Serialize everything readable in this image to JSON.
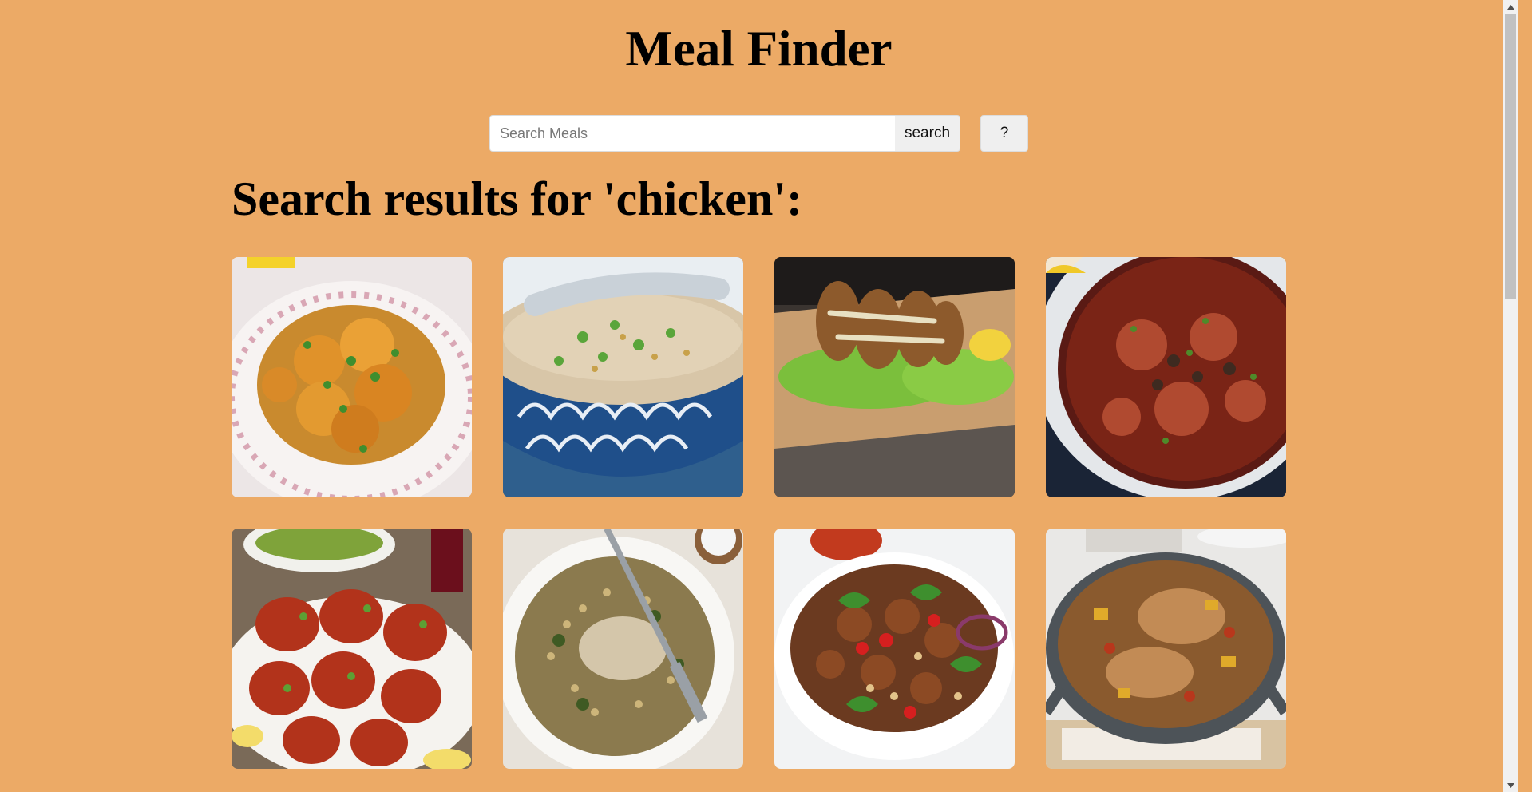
{
  "app": {
    "title": "Meal Finder"
  },
  "search": {
    "value": "",
    "placeholder": "Search Meals",
    "button_label": "search",
    "help_label": "?"
  },
  "results": {
    "heading": "Search results for 'chicken':"
  },
  "theme": {
    "background": "#ecaa66",
    "button_bg": "#efefef"
  },
  "meals": [
    {
      "icon": "curry-dish-icon"
    },
    {
      "icon": "congee-bowl-icon"
    },
    {
      "icon": "fried-chicken-board-icon"
    },
    {
      "icon": "casserole-pot-icon"
    },
    {
      "icon": "tandoori-chicken-icon"
    },
    {
      "icon": "couscous-bowl-icon"
    },
    {
      "icon": "stir-fry-bowl-icon"
    },
    {
      "icon": "paella-pan-icon"
    }
  ]
}
